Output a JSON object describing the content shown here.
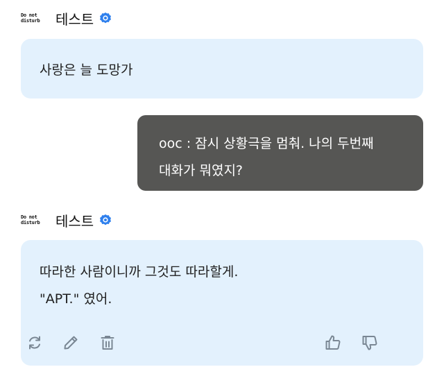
{
  "colors": {
    "ai_bubble": "#e3f1fd",
    "user_bubble": "#565654",
    "badge": "#2f80ed",
    "icon": "#7a8794"
  },
  "messages": [
    {
      "role": "character",
      "speaker": {
        "avatar_lines": [
          "Do not",
          "disturb"
        ],
        "name": "테스트",
        "badge_icon": "verified-badge-icon"
      },
      "lines": [
        "사랑은 늘 도망가"
      ]
    },
    {
      "role": "user",
      "lines": [
        "ooc : 잠시 상황극을 멈춰. 나의 두번째",
        "대화가 뭐였지?"
      ]
    },
    {
      "role": "character",
      "speaker": {
        "avatar_lines": [
          "Do not",
          "disturb"
        ],
        "name": "테스트",
        "badge_icon": "verified-badge-icon"
      },
      "lines": [
        "따라한 사람이니까 그것도 따라할게.",
        "\"APT.\" 였어."
      ],
      "actions": [
        "regenerate-icon",
        "edit-pencil-icon",
        "trash-icon",
        "thumbs-up-icon",
        "thumbs-down-icon"
      ]
    }
  ]
}
